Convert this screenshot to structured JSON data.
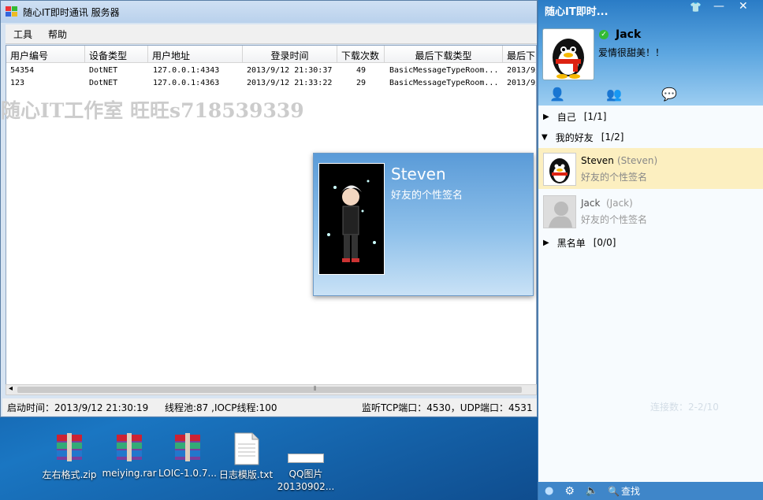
{
  "server": {
    "title": "随心IT即时通讯 服务器",
    "menu": [
      "工具",
      "帮助"
    ],
    "columns": [
      "用户编号",
      "设备类型",
      "用户地址",
      "登录时间",
      "下载次数",
      "最后下载类型",
      "最后下"
    ],
    "rows": [
      [
        "54354",
        "DotNET",
        "127.0.0.1:4343",
        "2013/9/12 21:30:37",
        "49",
        "BasicMessageTypeRoom...",
        "2013/9/"
      ],
      [
        "123",
        "DotNET",
        "127.0.0.1:4363",
        "2013/9/12 21:33:22",
        "29",
        "BasicMessageTypeRoom...",
        "2013/9/"
      ]
    ],
    "watermark": "随心IT工作室 旺旺s718539339",
    "status": {
      "start": "启动时间：2013/9/12 21:30:19",
      "threads": "线程池:87 ,IOCP线程:100",
      "ports": "监听TCP端口：4530，UDP端口：4531"
    }
  },
  "card": {
    "name": "Steven",
    "signature": "好友的个性签名"
  },
  "qq": {
    "title": "随心IT即时...",
    "user_name": "Jack",
    "user_signature": "爱情很甜美！！",
    "groups": [
      {
        "name": "自己",
        "count": "[1/1]"
      },
      {
        "name": "我的好友",
        "count": "[1/2]"
      },
      {
        "name": "黑名单",
        "count": "[0/0]"
      }
    ],
    "friends": [
      {
        "name": "Steven",
        "alias": "(Steven)",
        "signature": "好友的个性签名"
      },
      {
        "name": "Jack",
        "alias": "(Jack)",
        "signature": "好友的个性签名"
      }
    ],
    "search_label": "查找",
    "ghost_text": "连接数：2-2/10"
  },
  "desktop": {
    "icons": [
      "左右格式.zip",
      "meiying.rar",
      "LOIC-1.0.7...",
      "日志模版.txt",
      "QQ图片\n20130902..."
    ]
  }
}
